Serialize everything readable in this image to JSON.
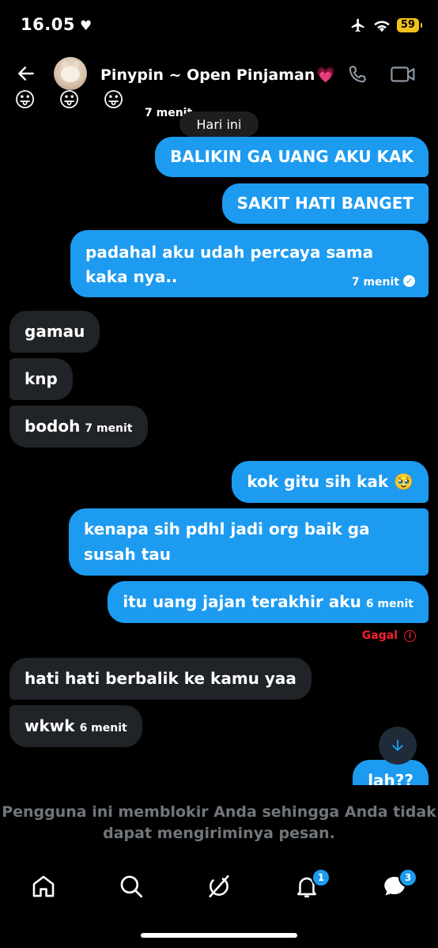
{
  "status_bar": {
    "time": "16.05",
    "battery": "59"
  },
  "header": {
    "name": "Pinypin ~ Open Pinjaman",
    "name_emoji": "💗"
  },
  "top_partial": {
    "emojis": [
      "😛",
      "😛",
      "😛"
    ],
    "time": "7 menit"
  },
  "date_separator": "Hari ini",
  "messages": [
    {
      "side": "sent",
      "text": "BALIKIN GA UANG AKU KAK"
    },
    {
      "side": "sent",
      "text": "SAKIT HATI BANGET"
    },
    {
      "side": "sent",
      "text": "padahal aku udah percaya sama kaka nya..",
      "time": "7 menit",
      "read": true
    },
    {
      "side": "recv",
      "text": "gamau"
    },
    {
      "side": "recv",
      "text": "knp"
    },
    {
      "side": "recv",
      "text": "bodoh",
      "time": "7 menit"
    },
    {
      "side": "sent",
      "text": "kok gitu sih kak 🥹"
    },
    {
      "side": "sent",
      "text": "kenapa sih pdhl jadi org baik ga susah tau"
    },
    {
      "side": "sent",
      "text": "itu uang jajan terakhir aku",
      "time": "6 menit"
    },
    {
      "side": "recv",
      "text": "hati hati berbalik ke kamu yaa"
    },
    {
      "side": "recv",
      "text": "wkwk",
      "time": "6 menit"
    },
    {
      "side": "sent",
      "text": "lah??"
    }
  ],
  "failed_label": "Gagal",
  "blocked_notice": "Pengguna ini memblokir Anda sehingga Anda tidak dapat mengiriminya pesan.",
  "nav": {
    "notifications_badge": "1",
    "messages_badge": "3"
  },
  "colors": {
    "accent": "#1d9bf0",
    "received_bubble": "#202327",
    "error": "#f4212e",
    "muted": "#71767b"
  }
}
